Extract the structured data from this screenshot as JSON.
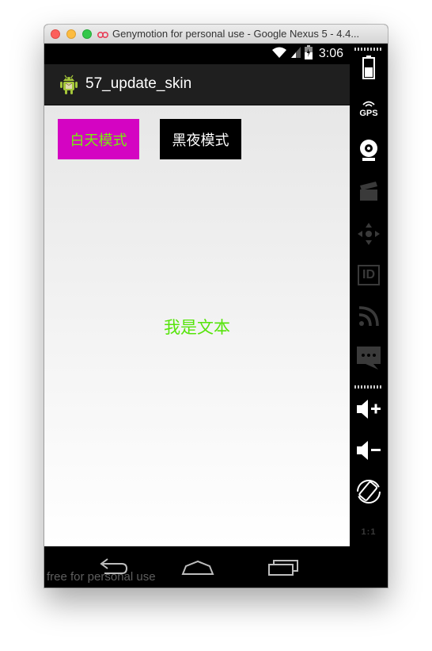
{
  "window": {
    "title": "Genymotion for personal use - Google Nexus 5 - 4.4..."
  },
  "status_bar": {
    "time": "3:06"
  },
  "action_bar": {
    "title": "57_update_skin"
  },
  "content": {
    "day_mode_button": "白天模式",
    "night_mode_button": "黑夜模式",
    "center_text": "我是文本"
  },
  "nav_bar": {
    "watermark": "free for personal use"
  },
  "sidebar": {
    "gps_label": "GPS",
    "id_label": "ID",
    "ratio_label": "1:1"
  },
  "colors": {
    "day_button_bg": "#d404c2",
    "day_button_text": "#77ef0a",
    "night_button_bg": "#000000",
    "center_text": "#56e40a"
  }
}
